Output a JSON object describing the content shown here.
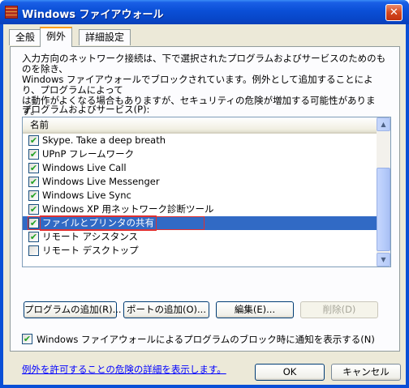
{
  "window": {
    "title": "Windows ファイアウォール",
    "close_glyph": "✕"
  },
  "tabs": [
    {
      "label": "全般",
      "active": false
    },
    {
      "label": "例外",
      "active": true
    },
    {
      "label": "詳細設定",
      "active": false
    }
  ],
  "exceptions": {
    "description": "入力方向のネットワーク接続は、下で選択されたプログラムおよびサービスのためのものを除き、\nWindows ファイアウォールでブロックされています。例外として追加することにより、プログラムによって\nは動作がよくなる場合もありますが、セキュリティの危険が増加する可能性があります。",
    "list_label": "プログラムおよびサービス(P):",
    "column_header": "名前",
    "items": [
      {
        "label": "Skype. Take a deep breath",
        "checked": true
      },
      {
        "label": "UPnP フレームワーク",
        "checked": true
      },
      {
        "label": "Windows Live Call",
        "checked": true
      },
      {
        "label": "Windows Live Messenger",
        "checked": true
      },
      {
        "label": "Windows Live Sync",
        "checked": true
      },
      {
        "label": "Windows XP 用ネットワーク診断ツール",
        "checked": true
      },
      {
        "label": "ファイルとプリンタの共有",
        "checked": true,
        "selected": true
      },
      {
        "label": "リモート アシスタンス",
        "checked": true
      },
      {
        "label": "リモート デスクトップ",
        "checked": false
      }
    ],
    "buttons": {
      "add_program": "プログラムの追加(R)...",
      "add_port": "ポートの追加(O)...",
      "edit": "編集(E)...",
      "delete": "削除(D)"
    },
    "notify_label": "Windows ファイアウォールによるプログラムのブロック時に通知を表示する(N)",
    "notify_checked": true,
    "risk_link": "例外を許可することの危険の詳細を表示します。"
  },
  "footer": {
    "ok": "OK",
    "cancel": "キャンセル"
  },
  "colors": {
    "titlebar": "#0a4fd6",
    "selection": "#316ac5",
    "focus_outline": "#e03030",
    "link": "#0000ff"
  }
}
